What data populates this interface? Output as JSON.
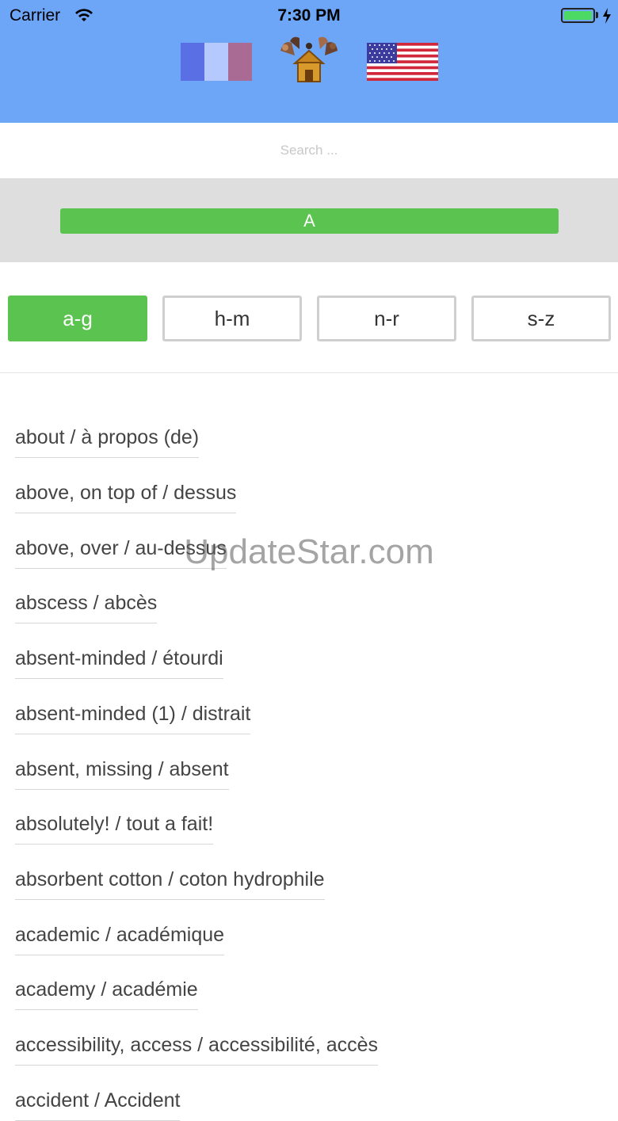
{
  "status_bar": {
    "carrier": "Carrier",
    "time": "7:30 PM"
  },
  "header": {
    "left_flag": "french-flag",
    "logo": "family-home-logo",
    "right_flag": "us-flag"
  },
  "search": {
    "placeholder": "Search ..."
  },
  "letter": {
    "label": "A"
  },
  "ranges": [
    {
      "label": "a-g",
      "active": true
    },
    {
      "label": "h-m",
      "active": false
    },
    {
      "label": "n-r",
      "active": false
    },
    {
      "label": "s-z",
      "active": false
    }
  ],
  "words": [
    "about / à propos (de)",
    "above, on top of / dessus",
    "above, over / au-dessus",
    "abscess / abcès",
    "absent-minded / étourdi",
    "absent-minded (1) / distrait",
    "absent, missing / absent",
    "absolutely! / tout a fait!",
    "absorbent cotton / coton hydrophile",
    "academic / académique",
    "academy / académie",
    "accessibility, access / accessibilité, accès",
    "accident / Accident"
  ],
  "watermark": "UpdateStar.com",
  "colors": {
    "header": "#6da5f7",
    "accent_green": "#5bc34f",
    "letter_bar": "#dedede"
  }
}
